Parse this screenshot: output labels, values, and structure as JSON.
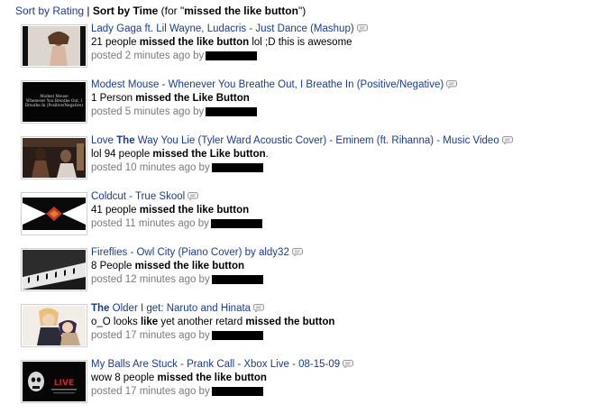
{
  "sort": {
    "by_rating": "Sort by Rating",
    "separator": "|",
    "by_time": "Sort by Time",
    "for_prefix": "(for \"",
    "query": "missed the like button",
    "for_suffix": "\")"
  },
  "items": [
    {
      "title": "Lady Gaga ft. Lil Wayne, Ludacris - Just Dance (Mashup)",
      "comment_pre": "21 people ",
      "comment_bold": "missed the like button",
      "comment_post": " lol ;D this is awesome",
      "meta": "posted 2 minutes ago by"
    },
    {
      "title": "Modest Mouse - Whenever You Breathe Out, I Breathe In (Positive/Negative)",
      "comment_pre": "1 Person ",
      "comment_bold": "missed the Like Button",
      "comment_post": "",
      "meta": "posted 5 minutes ago by",
      "thumb_text": "Modest Mouse Whenever You Breathe Out, I Breathe In (Positive/Negative)"
    },
    {
      "title_pre": "Love ",
      "title_bold": "The",
      "title_post": " Way You Lie (Tyler Ward Acoustic Cover) - Eminem (ft. Rihanna) - Music Video",
      "comment_pre": "lol 94 people ",
      "comment_bold": "missed the Like button",
      "comment_post": ".",
      "meta": "posted 10 minutes ago by"
    },
    {
      "title": "Coldcut - True Skool",
      "comment_pre": "41 people ",
      "comment_bold": "missed the like button",
      "comment_post": "",
      "meta": "posted 11 minutes ago by"
    },
    {
      "title": "Fireflies - Owl City (Piano Cover) by aldy32",
      "comment_pre": "8 People ",
      "comment_bold": "missed the like button",
      "comment_post": "",
      "meta": "posted 12 minutes ago by"
    },
    {
      "title_pre": "",
      "title_bold": "The",
      "title_post": " Older I get: Naruto and Hinata",
      "comment_pre": "o_O looks ",
      "comment_bold": "like",
      "comment_mid": " yet another retard ",
      "comment_bold2": "missed the button",
      "comment_post": "",
      "meta": "posted 17 minutes ago by"
    },
    {
      "title": "My Balls Are Stuck - Prank Call - Xbox Live - 08-15-09",
      "comment_pre": "wow 8 people ",
      "comment_bold": "missed the like button",
      "comment_post": "",
      "meta": "posted 17 minutes ago by",
      "thumb_text": "LIVE"
    }
  ]
}
